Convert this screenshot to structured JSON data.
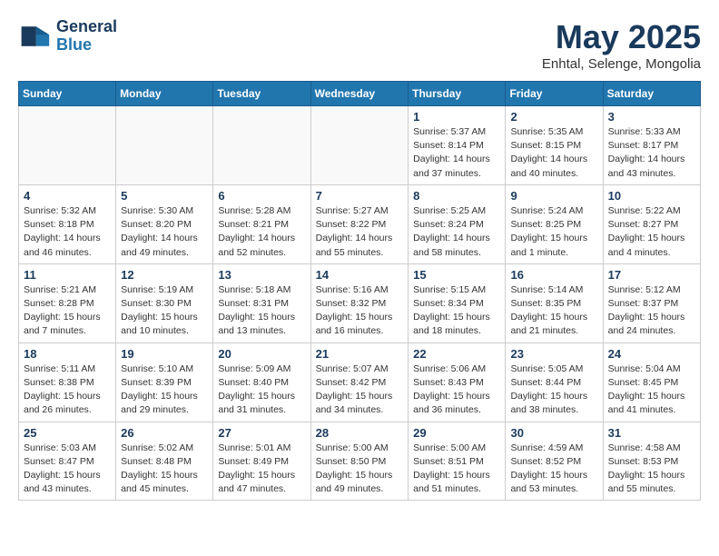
{
  "logo": {
    "line1": "General",
    "line2": "Blue"
  },
  "title": "May 2025",
  "subtitle": "Enhtal, Selenge, Mongolia",
  "weekdays": [
    "Sunday",
    "Monday",
    "Tuesday",
    "Wednesday",
    "Thursday",
    "Friday",
    "Saturday"
  ],
  "weeks": [
    [
      {
        "day": "",
        "info": ""
      },
      {
        "day": "",
        "info": ""
      },
      {
        "day": "",
        "info": ""
      },
      {
        "day": "",
        "info": ""
      },
      {
        "day": "1",
        "info": "Sunrise: 5:37 AM\nSunset: 8:14 PM\nDaylight: 14 hours\nand 37 minutes."
      },
      {
        "day": "2",
        "info": "Sunrise: 5:35 AM\nSunset: 8:15 PM\nDaylight: 14 hours\nand 40 minutes."
      },
      {
        "day": "3",
        "info": "Sunrise: 5:33 AM\nSunset: 8:17 PM\nDaylight: 14 hours\nand 43 minutes."
      }
    ],
    [
      {
        "day": "4",
        "info": "Sunrise: 5:32 AM\nSunset: 8:18 PM\nDaylight: 14 hours\nand 46 minutes."
      },
      {
        "day": "5",
        "info": "Sunrise: 5:30 AM\nSunset: 8:20 PM\nDaylight: 14 hours\nand 49 minutes."
      },
      {
        "day": "6",
        "info": "Sunrise: 5:28 AM\nSunset: 8:21 PM\nDaylight: 14 hours\nand 52 minutes."
      },
      {
        "day": "7",
        "info": "Sunrise: 5:27 AM\nSunset: 8:22 PM\nDaylight: 14 hours\nand 55 minutes."
      },
      {
        "day": "8",
        "info": "Sunrise: 5:25 AM\nSunset: 8:24 PM\nDaylight: 14 hours\nand 58 minutes."
      },
      {
        "day": "9",
        "info": "Sunrise: 5:24 AM\nSunset: 8:25 PM\nDaylight: 15 hours\nand 1 minute."
      },
      {
        "day": "10",
        "info": "Sunrise: 5:22 AM\nSunset: 8:27 PM\nDaylight: 15 hours\nand 4 minutes."
      }
    ],
    [
      {
        "day": "11",
        "info": "Sunrise: 5:21 AM\nSunset: 8:28 PM\nDaylight: 15 hours\nand 7 minutes."
      },
      {
        "day": "12",
        "info": "Sunrise: 5:19 AM\nSunset: 8:30 PM\nDaylight: 15 hours\nand 10 minutes."
      },
      {
        "day": "13",
        "info": "Sunrise: 5:18 AM\nSunset: 8:31 PM\nDaylight: 15 hours\nand 13 minutes."
      },
      {
        "day": "14",
        "info": "Sunrise: 5:16 AM\nSunset: 8:32 PM\nDaylight: 15 hours\nand 16 minutes."
      },
      {
        "day": "15",
        "info": "Sunrise: 5:15 AM\nSunset: 8:34 PM\nDaylight: 15 hours\nand 18 minutes."
      },
      {
        "day": "16",
        "info": "Sunrise: 5:14 AM\nSunset: 8:35 PM\nDaylight: 15 hours\nand 21 minutes."
      },
      {
        "day": "17",
        "info": "Sunrise: 5:12 AM\nSunset: 8:37 PM\nDaylight: 15 hours\nand 24 minutes."
      }
    ],
    [
      {
        "day": "18",
        "info": "Sunrise: 5:11 AM\nSunset: 8:38 PM\nDaylight: 15 hours\nand 26 minutes."
      },
      {
        "day": "19",
        "info": "Sunrise: 5:10 AM\nSunset: 8:39 PM\nDaylight: 15 hours\nand 29 minutes."
      },
      {
        "day": "20",
        "info": "Sunrise: 5:09 AM\nSunset: 8:40 PM\nDaylight: 15 hours\nand 31 minutes."
      },
      {
        "day": "21",
        "info": "Sunrise: 5:07 AM\nSunset: 8:42 PM\nDaylight: 15 hours\nand 34 minutes."
      },
      {
        "day": "22",
        "info": "Sunrise: 5:06 AM\nSunset: 8:43 PM\nDaylight: 15 hours\nand 36 minutes."
      },
      {
        "day": "23",
        "info": "Sunrise: 5:05 AM\nSunset: 8:44 PM\nDaylight: 15 hours\nand 38 minutes."
      },
      {
        "day": "24",
        "info": "Sunrise: 5:04 AM\nSunset: 8:45 PM\nDaylight: 15 hours\nand 41 minutes."
      }
    ],
    [
      {
        "day": "25",
        "info": "Sunrise: 5:03 AM\nSunset: 8:47 PM\nDaylight: 15 hours\nand 43 minutes."
      },
      {
        "day": "26",
        "info": "Sunrise: 5:02 AM\nSunset: 8:48 PM\nDaylight: 15 hours\nand 45 minutes."
      },
      {
        "day": "27",
        "info": "Sunrise: 5:01 AM\nSunset: 8:49 PM\nDaylight: 15 hours\nand 47 minutes."
      },
      {
        "day": "28",
        "info": "Sunrise: 5:00 AM\nSunset: 8:50 PM\nDaylight: 15 hours\nand 49 minutes."
      },
      {
        "day": "29",
        "info": "Sunrise: 5:00 AM\nSunset: 8:51 PM\nDaylight: 15 hours\nand 51 minutes."
      },
      {
        "day": "30",
        "info": "Sunrise: 4:59 AM\nSunset: 8:52 PM\nDaylight: 15 hours\nand 53 minutes."
      },
      {
        "day": "31",
        "info": "Sunrise: 4:58 AM\nSunset: 8:53 PM\nDaylight: 15 hours\nand 55 minutes."
      }
    ]
  ]
}
